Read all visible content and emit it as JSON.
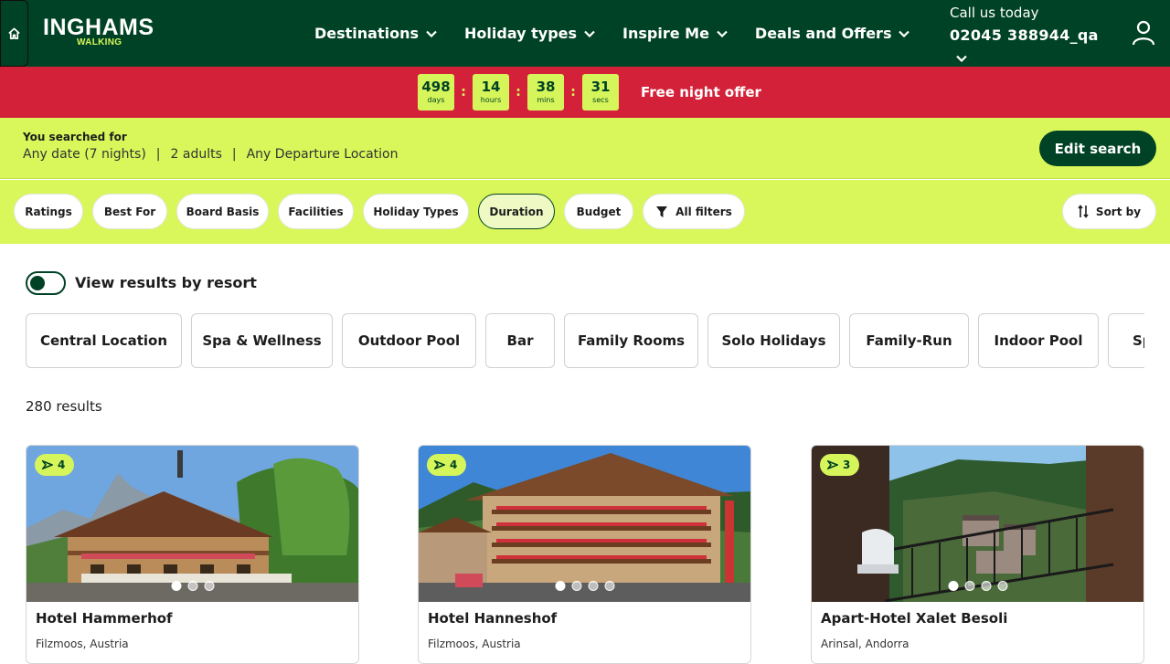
{
  "header": {
    "logo_main": "INGHAMS",
    "logo_sub": "WALKING",
    "nav": [
      {
        "label": "Destinations"
      },
      {
        "label": "Holiday types"
      },
      {
        "label": "Inspire Me"
      },
      {
        "label": "Deals and Offers"
      }
    ],
    "call_label": "Call us today",
    "call_number": "02045 388944_qa"
  },
  "offer": {
    "timer": [
      {
        "value": "498",
        "unit": "days"
      },
      {
        "value": "14",
        "unit": "hours"
      },
      {
        "value": "38",
        "unit": "mins"
      },
      {
        "value": "31",
        "unit": "secs"
      }
    ],
    "separator": ":",
    "text": "Free night offer"
  },
  "search": {
    "title": "You searched for",
    "date": "Any date (7 nights)",
    "guests": "2 adults",
    "departure": "Any Departure Location",
    "separator": "|",
    "edit_label": "Edit search"
  },
  "filters": {
    "pills": [
      {
        "label": "Ratings"
      },
      {
        "label": "Best For"
      },
      {
        "label": "Board Basis"
      },
      {
        "label": "Facilities"
      },
      {
        "label": "Holiday Types"
      },
      {
        "label": "Duration",
        "active": true
      },
      {
        "label": "Budget"
      }
    ],
    "all_filters_label": "All filters",
    "sort_label": "Sort by"
  },
  "view_by_resort": {
    "label": "View results by resort",
    "on": true
  },
  "facility_chips": [
    {
      "label": "Central Location"
    },
    {
      "label": "Spa & Wellness"
    },
    {
      "label": "Outdoor Pool"
    },
    {
      "label": "Bar"
    },
    {
      "label": "Family Rooms"
    },
    {
      "label": "Solo Holidays"
    },
    {
      "label": "Family-Run"
    },
    {
      "label": "Indoor Pool"
    },
    {
      "label": "Sp"
    }
  ],
  "results_count": "280 results",
  "cards": [
    {
      "title": "Hotel Hammerhof",
      "location": "Filzmoos, Austria",
      "rating": "4",
      "images": 3,
      "active_image": 1
    },
    {
      "title": "Hotel Hanneshof",
      "location": "Filzmoos, Austria",
      "rating": "4",
      "images": 4,
      "active_image": 1
    },
    {
      "title": "Apart-Hotel Xalet Besoli",
      "location": "Arinsal, Andorra",
      "rating": "3",
      "images": 4,
      "active_image": 1
    }
  ],
  "colors": {
    "brand_green": "#004225",
    "accent_lime": "#d9f75a",
    "offer_red": "#d4213a"
  }
}
